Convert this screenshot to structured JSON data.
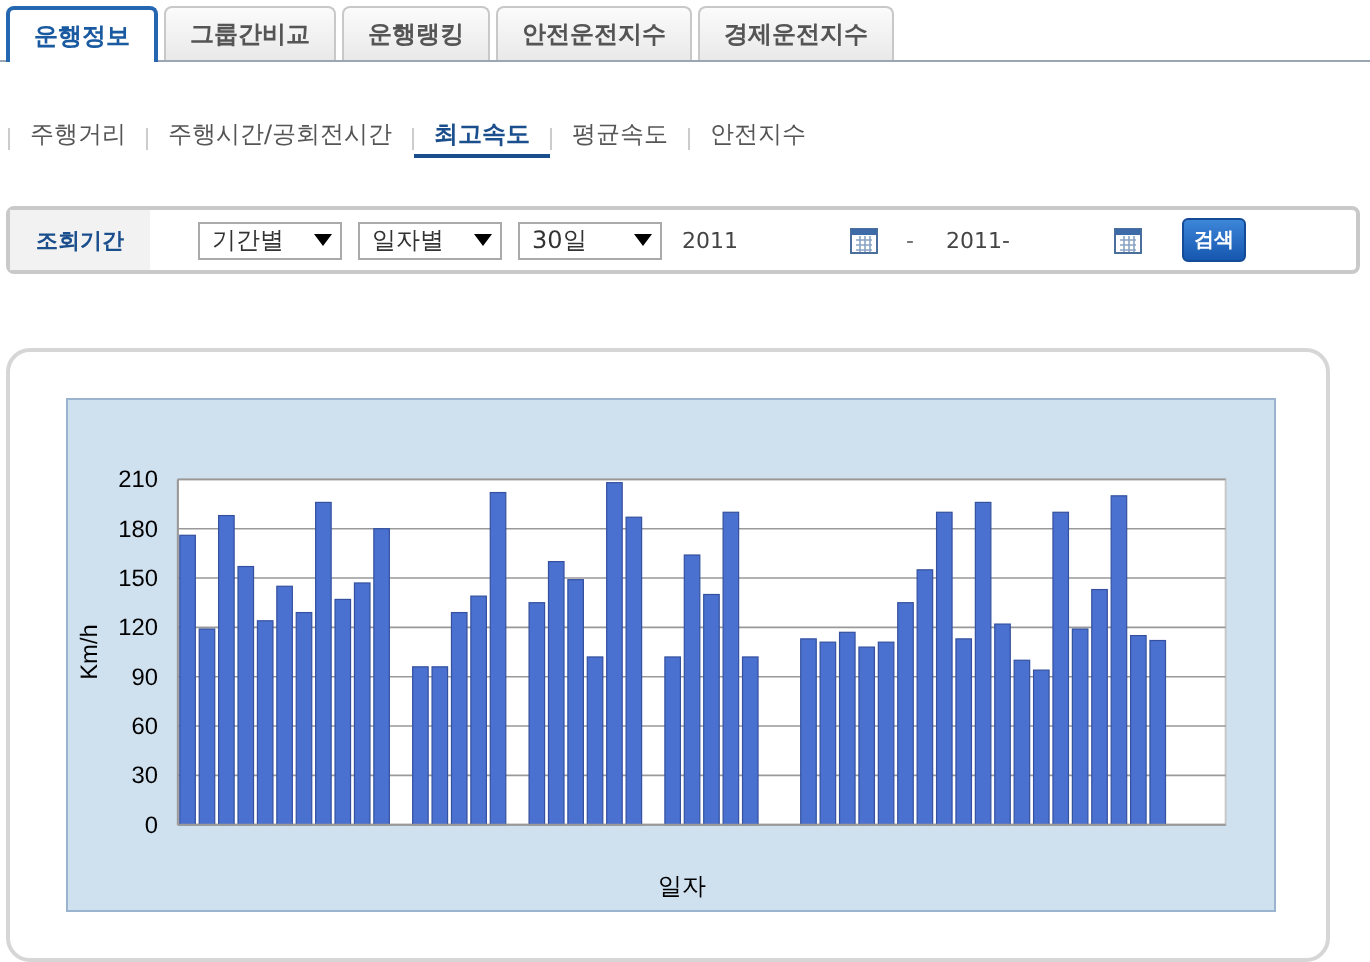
{
  "tabs": [
    {
      "label": "운행정보",
      "selected": true
    },
    {
      "label": "그룹간비교",
      "selected": false
    },
    {
      "label": "운행랭킹",
      "selected": false
    },
    {
      "label": "안전운전지수",
      "selected": false
    },
    {
      "label": "경제운전지수",
      "selected": false
    }
  ],
  "subnav": [
    {
      "label": "주행거리",
      "selected": false
    },
    {
      "label": "주행시간/공회전시간",
      "selected": false
    },
    {
      "label": "최고속도",
      "selected": true
    },
    {
      "label": "평균속도",
      "selected": false
    },
    {
      "label": "안전지수",
      "selected": false
    }
  ],
  "filter": {
    "label": "조회기간",
    "selects": [
      {
        "value": "기간별"
      },
      {
        "value": "일자별"
      },
      {
        "value": "30일"
      }
    ],
    "date_from": {
      "value": "2011"
    },
    "separator": "-",
    "date_to": {
      "value": "2011-"
    },
    "search_button": "검색"
  },
  "chart": {
    "chart_data": {
      "type": "bar",
      "xlabel": "일자",
      "ylabel": "Km/h",
      "ylim": [
        0,
        210
      ],
      "grid": true,
      "yticks": [
        0,
        30,
        60,
        90,
        120,
        150,
        180,
        210
      ],
      "values": [
        176,
        119,
        188,
        157,
        124,
        145,
        129,
        196,
        137,
        147,
        180,
        0,
        96,
        96,
        129,
        139,
        202,
        0,
        135,
        160,
        149,
        102,
        208,
        187,
        0,
        102,
        164,
        140,
        190,
        102,
        0,
        0,
        113,
        111,
        117,
        108,
        111,
        135,
        155,
        190,
        113,
        196,
        122,
        100,
        94,
        190,
        119,
        143,
        200,
        115,
        112,
        0,
        0,
        0
      ]
    }
  }
}
